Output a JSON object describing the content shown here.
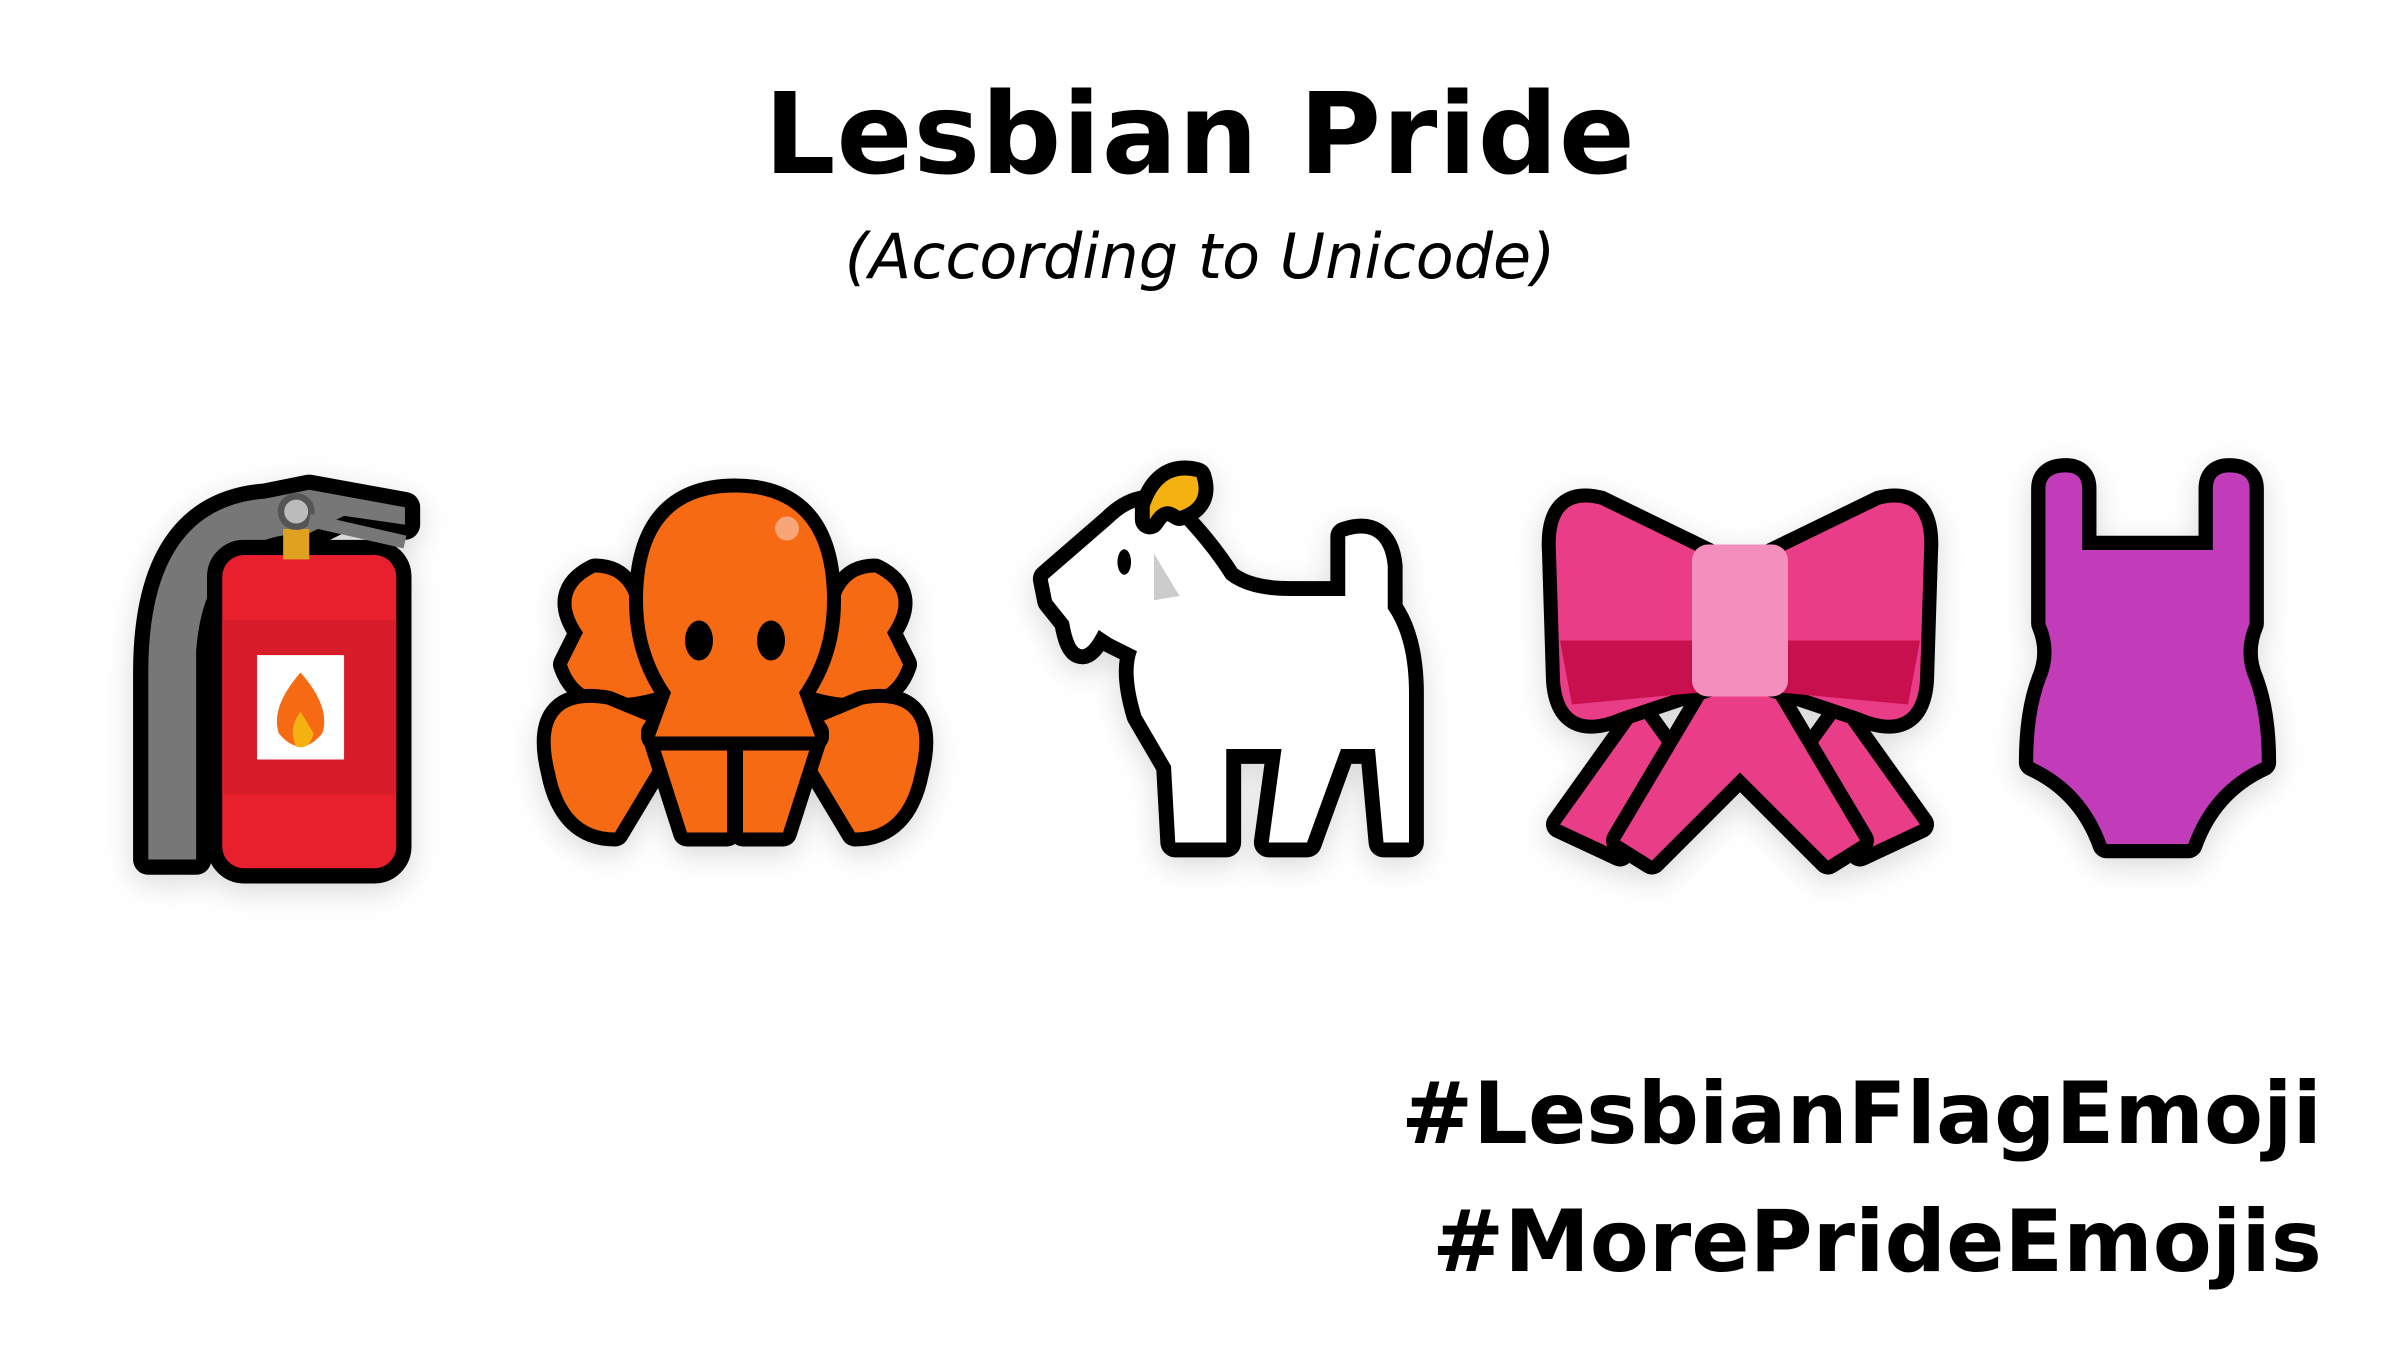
{
  "title": "Lesbian Pride",
  "subtitle": "(According to Unicode)",
  "emojis": [
    {
      "name": "fire-extinguisher",
      "color": "#e8202e"
    },
    {
      "name": "octopus",
      "color": "#f56a12"
    },
    {
      "name": "goat",
      "color": "#ffffff"
    },
    {
      "name": "ribbon",
      "color": "#ea3d87"
    },
    {
      "name": "one-piece-swimsuit",
      "color": "#c23bb8"
    }
  ],
  "hashtags": [
    "#LesbianFlagEmoji",
    "#MorePrideEmojis"
  ]
}
